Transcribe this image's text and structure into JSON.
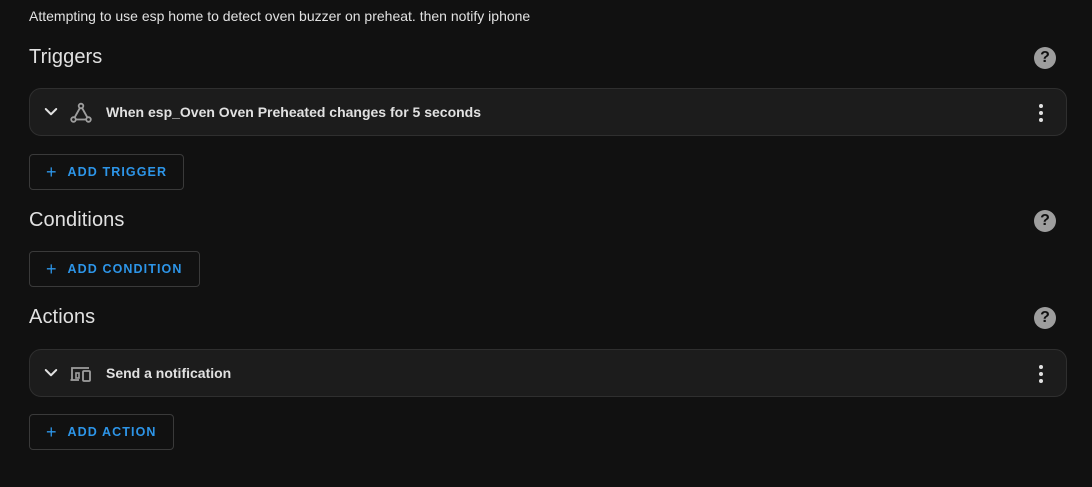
{
  "description": "Attempting to use esp home to detect oven buzzer on preheat. then notify iphone",
  "triggers": {
    "title": "Triggers",
    "help_icon": "?",
    "items": [
      {
        "label": "When esp_Oven Oven Preheated changes for 5 seconds",
        "icon": "state-trigger-icon"
      }
    ],
    "add_label": "ADD TRIGGER",
    "add_icon": "+"
  },
  "conditions": {
    "title": "Conditions",
    "help_icon": "?",
    "items": [],
    "add_label": "ADD CONDITION",
    "add_icon": "+"
  },
  "actions": {
    "title": "Actions",
    "help_icon": "?",
    "items": [
      {
        "label": "Send a notification",
        "icon": "devices-icon"
      }
    ],
    "add_label": "ADD ACTION",
    "add_icon": "+"
  },
  "colors": {
    "background": "#111111",
    "card": "#1c1c1c",
    "accent": "#2d95e8",
    "text": "#e1e1e1",
    "icon": "#9e9e9e"
  }
}
